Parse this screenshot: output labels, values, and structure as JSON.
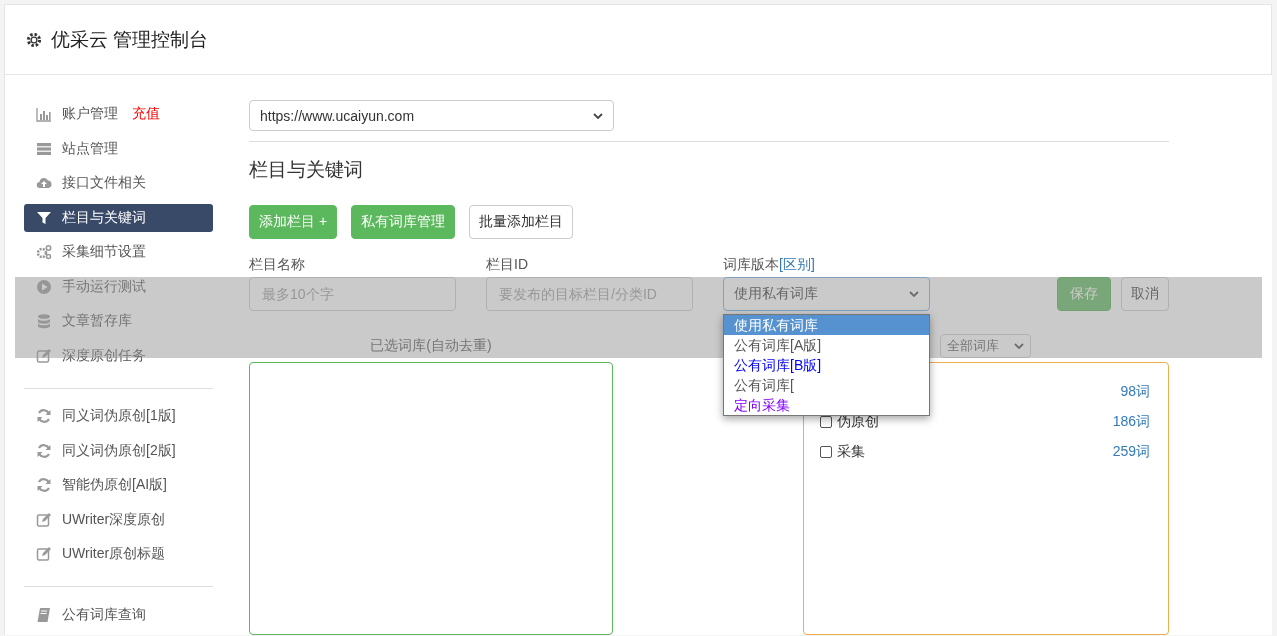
{
  "header": {
    "title": "优采云 管理控制台"
  },
  "sidebar": {
    "groups": [
      [
        {
          "label": "账户管理",
          "kind": "chart",
          "selected": false,
          "badge": "充值"
        },
        {
          "label": "站点管理",
          "kind": "server",
          "selected": false
        },
        {
          "label": "接口文件相关",
          "kind": "cloud",
          "selected": false
        },
        {
          "label": "栏目与关键词",
          "kind": "filter",
          "selected": true
        },
        {
          "label": "采集细节设置",
          "kind": "gears",
          "selected": false
        },
        {
          "label": "手动运行测试",
          "kind": "play",
          "selected": false
        },
        {
          "label": "文章暂存库",
          "kind": "database",
          "selected": false
        },
        {
          "label": "深度原创任务",
          "kind": "edit",
          "selected": false
        }
      ],
      [
        {
          "label": "同义词伪原创[1版]",
          "kind": "refresh",
          "selected": false
        },
        {
          "label": "同义词伪原创[2版]",
          "kind": "refresh",
          "selected": false
        },
        {
          "label": "智能伪原创[AI版]",
          "kind": "refresh",
          "selected": false
        },
        {
          "label": "UWriter深度原创",
          "kind": "edit",
          "selected": false
        },
        {
          "label": "UWriter原创标题",
          "kind": "edit",
          "selected": false
        }
      ],
      [
        {
          "label": "公有词库查询",
          "kind": "book",
          "selected": false
        }
      ]
    ]
  },
  "site_select": {
    "value": "https://www.ucaiyun.com"
  },
  "section_title": "栏目与关键词",
  "toolbar": [
    {
      "label": "添加栏目 +",
      "kind": "primary"
    },
    {
      "label": "私有词库管理",
      "kind": "primary"
    },
    {
      "label": "批量添加栏目",
      "kind": "default"
    }
  ],
  "form": {
    "name": {
      "label": "栏目名称",
      "placeholder": "最多10个字"
    },
    "id": {
      "label": "栏目ID",
      "placeholder": "要发布的目标栏目/分类ID"
    },
    "version": {
      "label": "词库版本",
      "link": "[区别]",
      "value": "使用私有词库",
      "options": [
        {
          "label": "使用私有词库",
          "selected": true
        },
        {
          "label": "公有词库[A版]",
          "selected": false,
          "kind": "plain"
        },
        {
          "label": "公有词库[B版]",
          "selected": false,
          "kind": "link"
        },
        {
          "label": "公有词库[",
          "selected": false,
          "kind": "plain"
        },
        {
          "label": "定向采集",
          "selected": false,
          "kind": "visited"
        }
      ]
    },
    "save": "保存",
    "cancel": "取消"
  },
  "selected_libraries": {
    "label": "已选词库(自动去重)"
  },
  "libraries": {
    "filter": "全部词库",
    "items": [
      {
        "count": "98词"
      },
      {
        "label": "伪原创",
        "checked": false,
        "count": "186词"
      },
      {
        "label": "采集",
        "checked": false,
        "count": "259词"
      }
    ]
  }
}
